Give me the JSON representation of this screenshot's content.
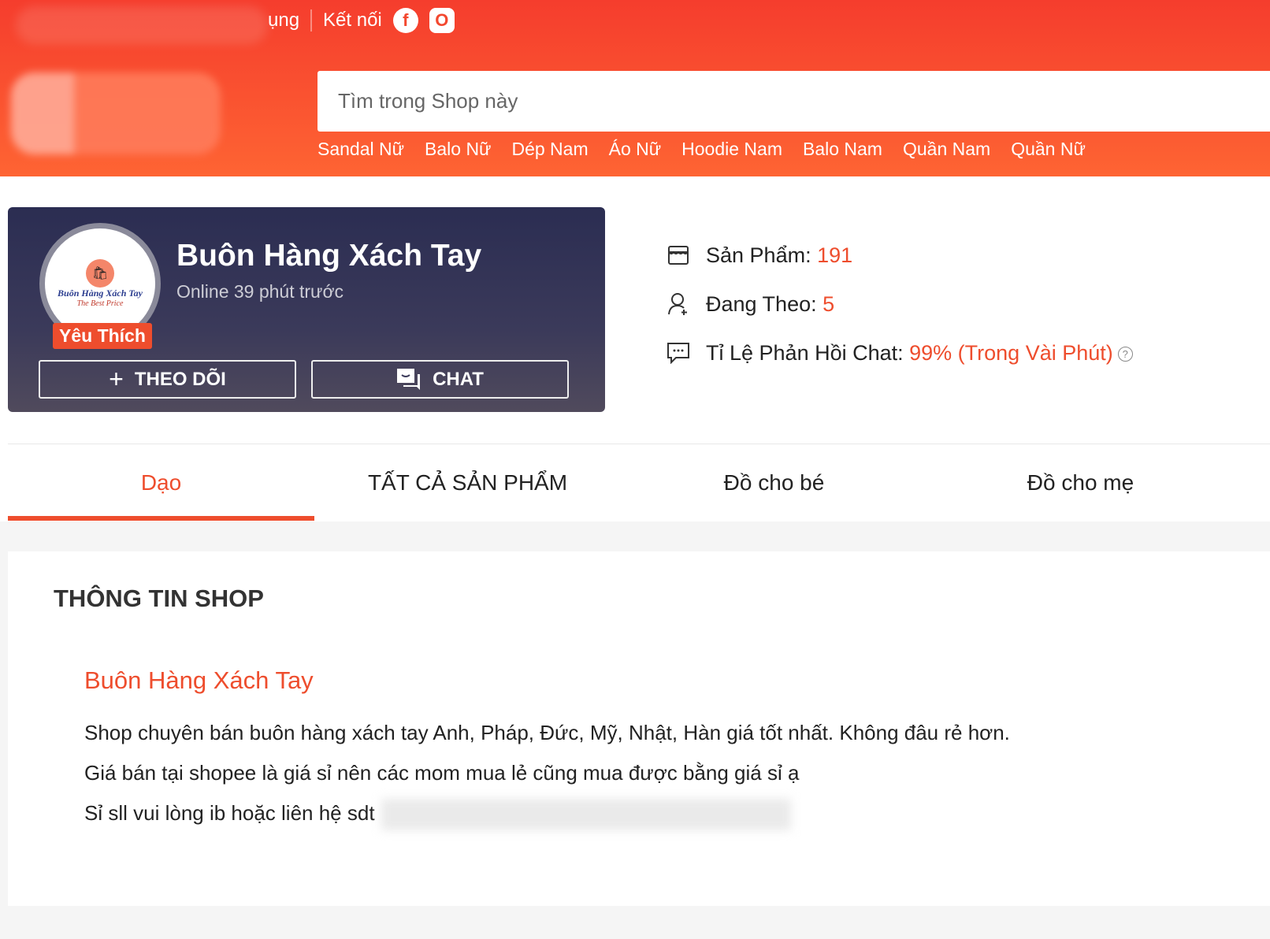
{
  "header": {
    "top_links": {
      "partial": "ụng",
      "connect": "Kết nối"
    },
    "social": [
      {
        "icon": "facebook-icon",
        "label": "f"
      },
      {
        "icon": "instagram-icon",
        "label": "O"
      }
    ],
    "search": {
      "placeholder": "Tìm trong Shop này"
    },
    "categories": [
      "Sandal Nữ",
      "Balo Nữ",
      "Dép Nam",
      "Áo Nữ",
      "Hoodie Nam",
      "Balo Nam",
      "Quần Nam",
      "Quần Nữ"
    ]
  },
  "shop": {
    "name": "Buôn Hàng Xách Tay",
    "online": "Online 39 phút trước",
    "badge": "Yêu Thích",
    "logo_line1": "Buôn Hàng Xách Tay",
    "logo_line2": "The Best Price",
    "follow_label": "THEO DÕI",
    "chat_label": "CHAT"
  },
  "stats": [
    {
      "label": "Sản Phẩm: ",
      "value": "191"
    },
    {
      "label": "Đang Theo: ",
      "value": "5"
    },
    {
      "label": "Tỉ Lệ Phản Hồi Chat: ",
      "value": "99% (Trong Vài Phút)"
    }
  ],
  "tabs": [
    {
      "label": "Dạo",
      "active": true
    },
    {
      "label": "TẤT CẢ SẢN PHẨM"
    },
    {
      "label": "Đồ cho bé"
    },
    {
      "label": "Đồ cho mẹ"
    }
  ],
  "info": {
    "heading": "THÔNG TIN SHOP",
    "shop_name": "Buôn Hàng Xách Tay",
    "lines": [
      "Shop chuyên bán buôn hàng xách tay Anh, Pháp, Đức, Mỹ, Nhật, Hàn giá tốt nhất. Không đâu rẻ hơn.",
      "Giá bán tại shopee là giá sỉ nên các mom mua lẻ cũng mua được bằng giá sỉ ạ",
      "Sỉ sll vui lòng ib hoặc liên hệ sdt"
    ]
  },
  "colors": {
    "accent": "#ee4d2d",
    "header_top": "#f53d2d",
    "header_bottom": "#fe6433"
  }
}
